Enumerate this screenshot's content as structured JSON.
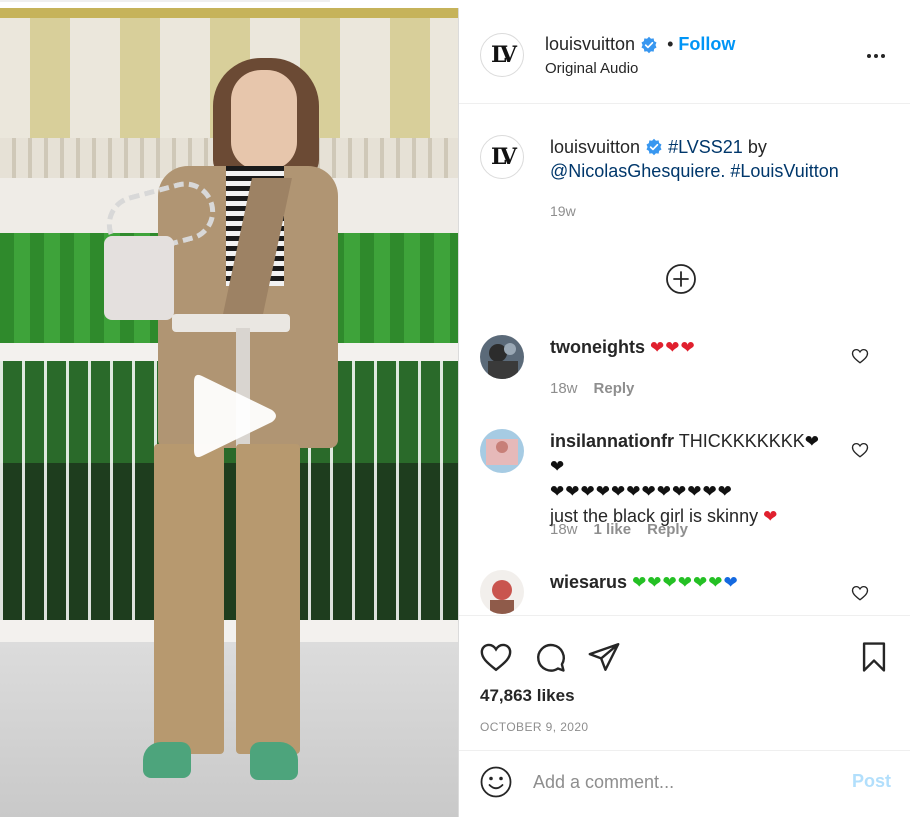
{
  "post": {
    "username": "louisvuitton",
    "follow_label": "Follow",
    "separator": "•",
    "audio": "Original Audio",
    "avatar_text": "LV"
  },
  "caption": {
    "username": "louisvuitton",
    "hashtag1": "#LVSS21",
    "by": " by ",
    "mention": "@NicolasGhesquiere.",
    "hashtag2": "#LouisVuitton",
    "time": "19w"
  },
  "comments": [
    {
      "username": "twoneights",
      "text": "",
      "emoji": "❤❤❤",
      "time": "18w",
      "likes": "",
      "reply_label": "Reply"
    },
    {
      "username": "insilannationfr",
      "text": "THICKKKKKKK",
      "emoji_line1": "❤❤",
      "emoji_line2": "❤❤❤❤❤❤❤❤❤❤❤❤",
      "text2": "just the black girl is skinny",
      "emoji_end": "❤",
      "time": "18w",
      "likes": "1 like",
      "reply_label": "Reply"
    },
    {
      "username": "wiesarus",
      "emoji_green": "❤❤❤❤❤❤",
      "emoji_blue": "❤"
    }
  ],
  "actions": {
    "likes": "47,863 likes",
    "date": "OCTOBER 9, 2020"
  },
  "composer": {
    "placeholder": "Add a comment...",
    "post_label": "Post"
  },
  "colors": {
    "accent": "#0095f6",
    "link": "#00376b",
    "muted": "#8e8e8e",
    "post_disabled": "#b2dffc"
  }
}
